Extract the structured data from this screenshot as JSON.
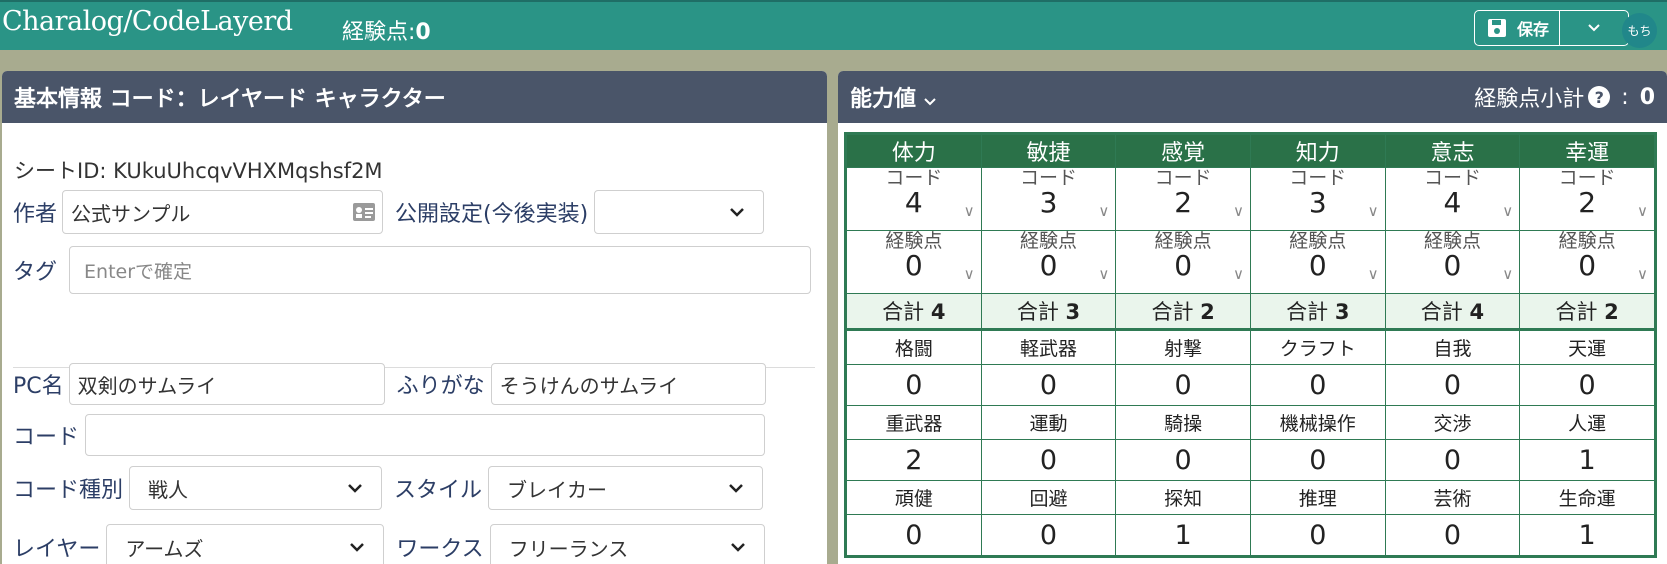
{
  "app": {
    "title": "Charalog/CodeLayerd",
    "xp_label": "経験点:",
    "xp_value": "0",
    "save_label": "保存",
    "user": "もち"
  },
  "basic": {
    "header": "基本情報 コード：レイヤード キャラクター",
    "sheet_id": "シートID: KUkuUhcqvVHXMqshsf2M",
    "author_label": "作者",
    "author_value": "公式サンプル",
    "visibility_label": "公開設定(今後実装)",
    "visibility_value": "",
    "tag_label": "タグ",
    "tag_placeholder": "Enterで確定",
    "pc_label": "PC名",
    "pc_value": "双剣のサムライ",
    "kana_label": "ふりがな",
    "kana_value": "そうけんのサムライ",
    "code_label": "コード",
    "code_value": "",
    "code_type_label": "コード種別",
    "code_type_value": "戦人",
    "style_label": "スタイル",
    "style_value": "ブレイカー",
    "layer_label": "レイヤー",
    "layer_value": "アームズ",
    "works_label": "ワークス",
    "works_value": "フリーランス"
  },
  "abilities": {
    "header": "能力値",
    "xp_subtotal_label": "経験点小計",
    "xp_subtotal_value": "0",
    "code_label": "コード",
    "xp_label": "経験点",
    "sum_label": "合計",
    "stats": [
      {
        "name": "体力",
        "code": "4",
        "xp": "0",
        "total": "4"
      },
      {
        "name": "敏捷",
        "code": "3",
        "xp": "0",
        "total": "3"
      },
      {
        "name": "感覚",
        "code": "2",
        "xp": "0",
        "total": "2"
      },
      {
        "name": "知力",
        "code": "3",
        "xp": "0",
        "total": "3"
      },
      {
        "name": "意志",
        "code": "4",
        "xp": "0",
        "total": "4"
      },
      {
        "name": "幸運",
        "code": "2",
        "xp": "0",
        "total": "2"
      }
    ],
    "skill_rows": [
      [
        {
          "n": "格闘",
          "v": "0"
        },
        {
          "n": "軽武器",
          "v": "0"
        },
        {
          "n": "射撃",
          "v": "0"
        },
        {
          "n": "クラフト",
          "v": "0"
        },
        {
          "n": "自我",
          "v": "0"
        },
        {
          "n": "天運",
          "v": "0"
        }
      ],
      [
        {
          "n": "重武器",
          "v": "2"
        },
        {
          "n": "運動",
          "v": "0"
        },
        {
          "n": "騎操",
          "v": "0"
        },
        {
          "n": "機械操作",
          "v": "0"
        },
        {
          "n": "交渉",
          "v": "0"
        },
        {
          "n": "人運",
          "v": "1"
        }
      ],
      [
        {
          "n": "頑健",
          "v": "0"
        },
        {
          "n": "回避",
          "v": "0"
        },
        {
          "n": "探知",
          "v": "1"
        },
        {
          "n": "推理",
          "v": "0"
        },
        {
          "n": "芸術",
          "v": "0"
        },
        {
          "n": "生命運",
          "v": "1"
        }
      ]
    ]
  }
}
